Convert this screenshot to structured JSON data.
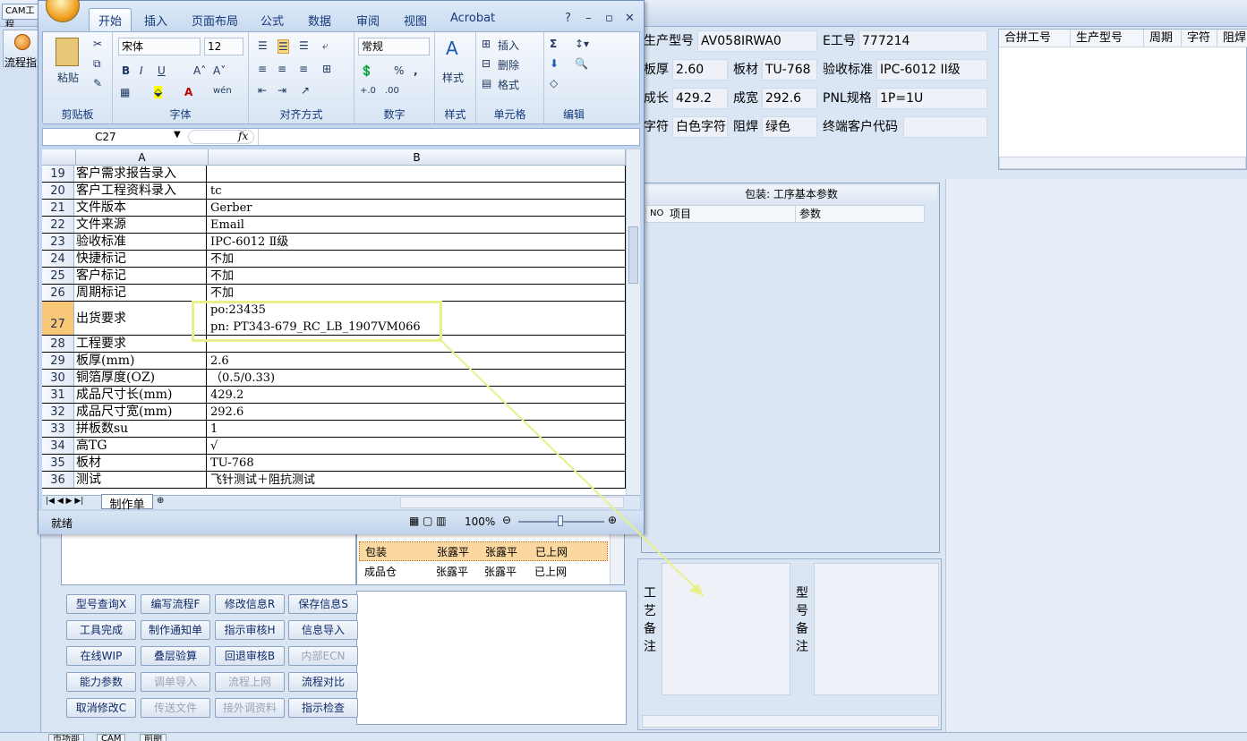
{
  "app": {
    "cam_tab": "CAM工程",
    "flow_btn": "流程指"
  },
  "bottom_tabs": [
    "市场部",
    "CAM",
    "前期"
  ],
  "right_fields": {
    "prod_model_lbl": "生产型号",
    "prod_model": "AV058IRWA0",
    "e_no_lbl": "E工号",
    "e_no": "777214",
    "thick_lbl": "板厚",
    "thick": "2.60",
    "material_lbl": "板材",
    "material": "TU-768",
    "accept_lbl": "验收标准",
    "accept": "IPC-6012 II级",
    "len_lbl": "成长",
    "len": "429.2",
    "wid_lbl": "成宽",
    "wid": "292.6",
    "pnl_lbl": "PNL规格",
    "pnl": "1P=1U",
    "char_lbl": "字符",
    "char": "白色字符",
    "mask_lbl": "阻焊",
    "mask": "绿色",
    "end_cust_lbl": "终端客户代码",
    "end_cust": ""
  },
  "hdr_grid_cols": [
    "合拼工号",
    "生产型号",
    "周期",
    "字符",
    "阻焊"
  ],
  "pack": {
    "title": "包装: 工序基本参数",
    "col_no": "NO",
    "col_item": "项目",
    "col_param": "参数"
  },
  "notes": {
    "left_label": [
      "工",
      "艺",
      "备",
      "注"
    ],
    "right_label": [
      "型",
      "号",
      "备",
      "注"
    ]
  },
  "mini_rows": [
    {
      "step": "包装",
      "a": "张露平",
      "b": "张露平",
      "c": "已上网"
    },
    {
      "step": "成品仓",
      "a": "张露平",
      "b": "张露平",
      "c": "已上网"
    }
  ],
  "buttons": [
    [
      "型号查询X",
      "编写流程F",
      "修改信息R",
      "保存信息S"
    ],
    [
      "工具完成",
      "制作通知单",
      "指示审核H",
      "信息导入"
    ],
    [
      "在线WIP",
      "叠层验算",
      "回退审核B",
      "内部ECN"
    ],
    [
      "能力参数",
      "调单导入",
      "流程上网",
      "流程对比"
    ],
    [
      "取消修改C",
      "传送文件",
      "接外调资料",
      "指示检查"
    ]
  ],
  "excel": {
    "tabs": [
      "开始",
      "插入",
      "页面布局",
      "公式",
      "数据",
      "审阅",
      "视图",
      "Acrobat"
    ],
    "font": "宋体",
    "size": "12",
    "numfmt": "常规",
    "groups": [
      "剪贴板",
      "字体",
      "对齐方式",
      "数字",
      "样式",
      "单元格",
      "编辑"
    ],
    "paste": "粘贴",
    "style": "样式",
    "insert": "插入",
    "delete": "删除",
    "format": "格式",
    "namebox": "C27",
    "fx": "fx",
    "colA": "A",
    "colB": "B",
    "rows": [
      {
        "n": "19",
        "a": "客户需求报告录入",
        "b": ""
      },
      {
        "n": "20",
        "a": "客户工程资料录入",
        "b": "tc"
      },
      {
        "n": "21",
        "a": "文件版本",
        "b": "Gerber"
      },
      {
        "n": "22",
        "a": "文件来源",
        "b": "Email"
      },
      {
        "n": "23",
        "a": "验收标准",
        "b": "IPC-6012 Ⅱ级"
      },
      {
        "n": "24",
        "a": "快捷标记",
        "b": "不加"
      },
      {
        "n": "25",
        "a": "客户标记",
        "b": "不加"
      },
      {
        "n": "26",
        "a": "周期标记",
        "b": "不加"
      },
      {
        "n": "27",
        "a": "出货要求",
        "b": "po:23435",
        "b2": "pn: PT343-679_RC_LB_1907VM066"
      },
      {
        "n": "28",
        "a": "工程要求",
        "b": ""
      },
      {
        "n": "29",
        "a": "板厚(mm)",
        "b": "2.6"
      },
      {
        "n": "30",
        "a": "铜箔厚度(OZ)",
        "b": "（0.5/0.33)"
      },
      {
        "n": "31",
        "a": "成品尺寸长(mm)",
        "b": "429.2"
      },
      {
        "n": "32",
        "a": "成品尺寸宽(mm)",
        "b": "292.6"
      },
      {
        "n": "33",
        "a": "拼板数su",
        "b": "1"
      },
      {
        "n": "34",
        "a": "高TG",
        "b": "√"
      },
      {
        "n": "35",
        "a": "板材",
        "b": "TU-768"
      },
      {
        "n": "36",
        "a": "测试",
        "b": "飞针测试＋阻抗测试"
      }
    ],
    "sheet_tab": "制作单",
    "status": "就绪",
    "zoom": "100%"
  }
}
